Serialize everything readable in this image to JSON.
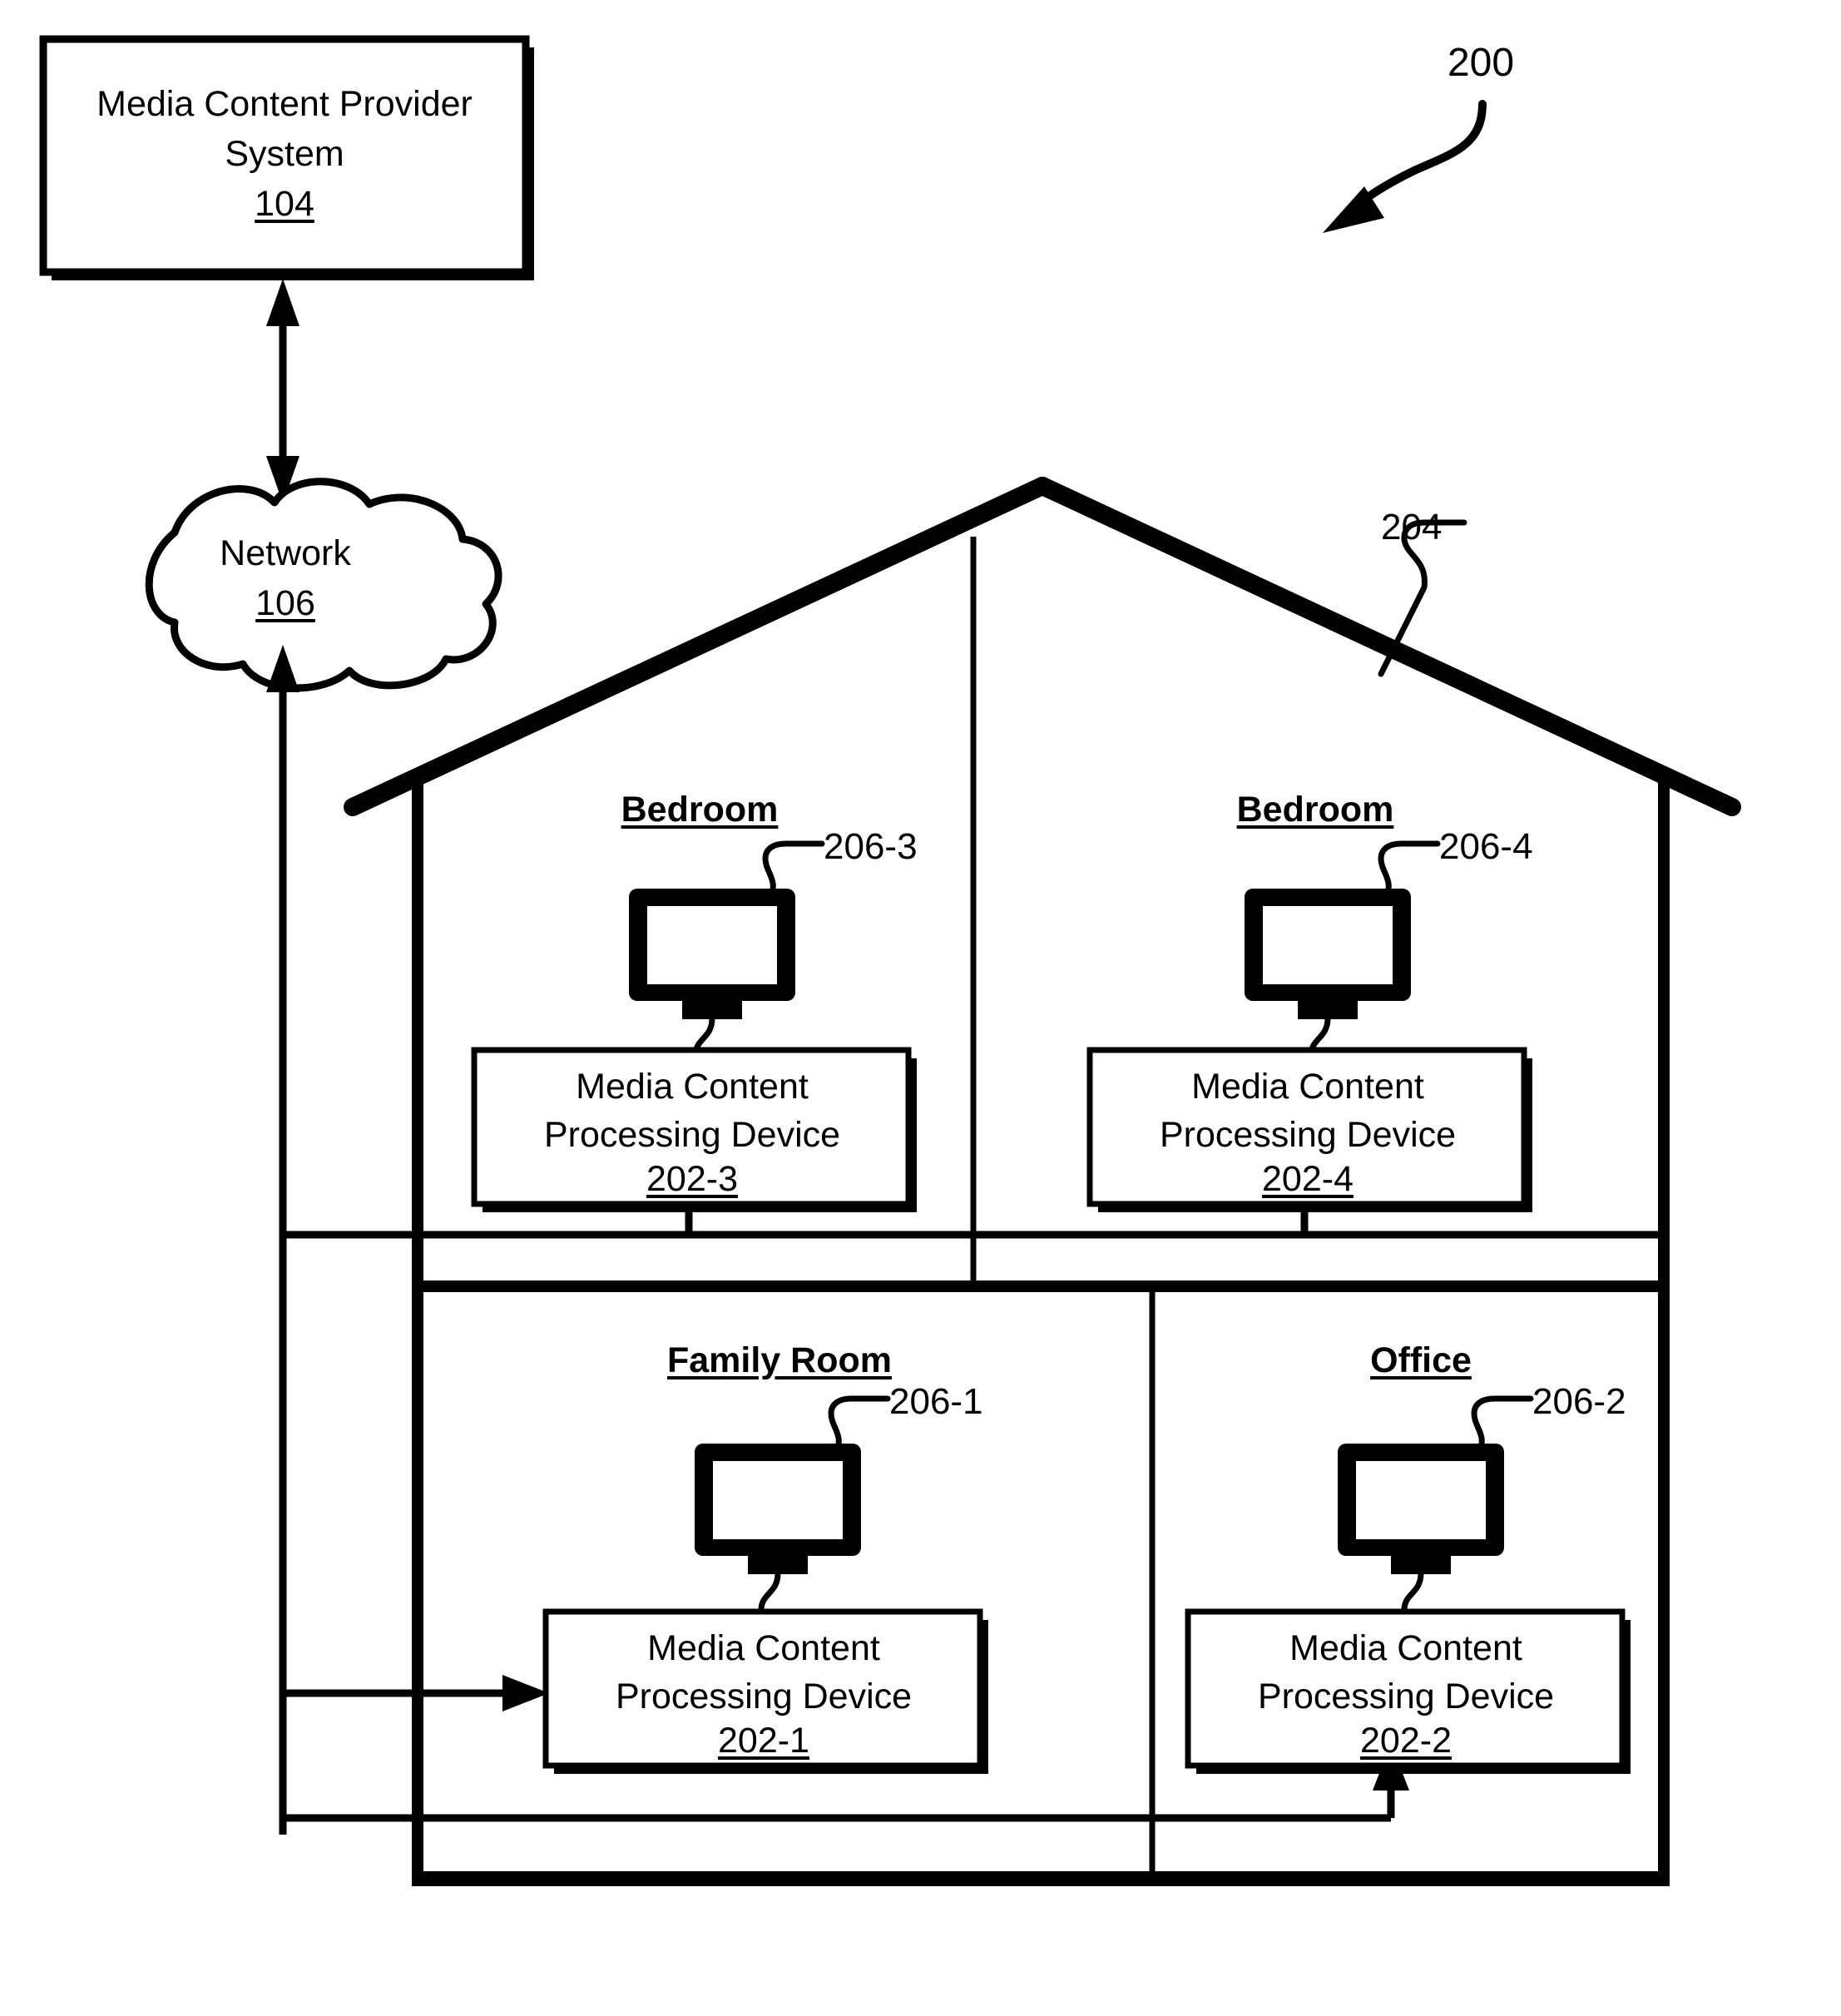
{
  "figure": {
    "reference_number": "200"
  },
  "provider_system": {
    "title_line1": "Media Content Provider",
    "title_line2": "System",
    "reference_number": "104"
  },
  "network": {
    "label": "Network",
    "reference_number": "106"
  },
  "house": {
    "reference_number": "204",
    "rooms": [
      {
        "name": "Bedroom",
        "display_ref": "206-3",
        "device_line1": "Media Content",
        "device_line2": "Processing Device",
        "device_ref": "202-3"
      },
      {
        "name": "Bedroom",
        "display_ref": "206-4",
        "device_line1": "Media Content",
        "device_line2": "Processing Device",
        "device_ref": "202-4"
      },
      {
        "name": "Family Room",
        "display_ref": "206-1",
        "device_line1": "Media Content",
        "device_line2": "Processing Device",
        "device_ref": "202-1"
      },
      {
        "name": "Office",
        "display_ref": "206-2",
        "device_line1": "Media Content",
        "device_line2": "Processing Device",
        "device_ref": "202-2"
      }
    ]
  },
  "colors": {
    "stroke": "#000000",
    "fill": "#ffffff"
  }
}
